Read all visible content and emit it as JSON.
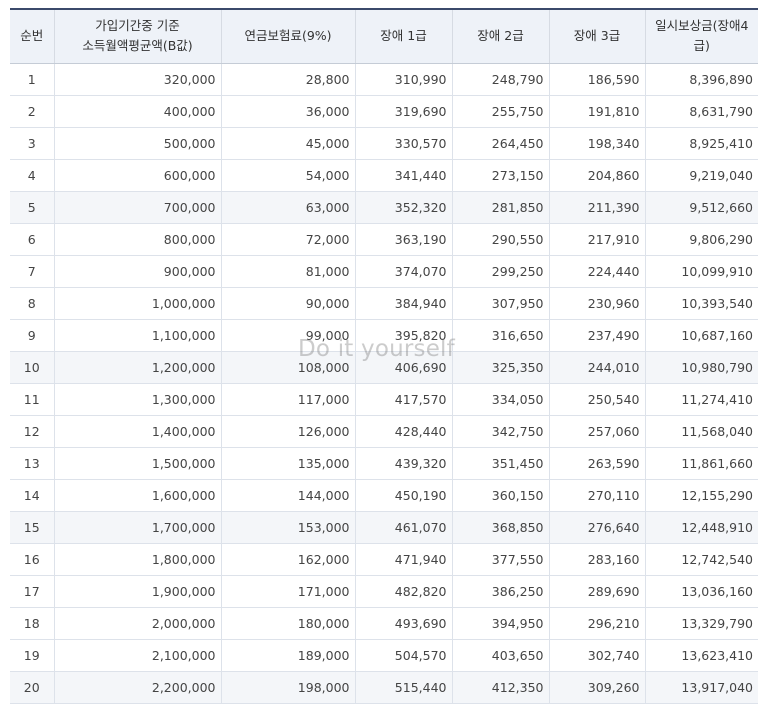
{
  "table": {
    "headers": {
      "no": "순번",
      "base_line1": "가입기간중 기준",
      "base_line2": "소득월액평균액(B값)",
      "premium": "연금보험료(9%)",
      "grade1": "장애 1급",
      "grade2": "장애 2급",
      "grade3": "장애 3급",
      "lump": "일시보상금(장애4급)"
    },
    "rows": [
      [
        "1",
        "320,000",
        "28,800",
        "310,990",
        "248,790",
        "186,590",
        "8,396,890"
      ],
      [
        "2",
        "400,000",
        "36,000",
        "319,690",
        "255,750",
        "191,810",
        "8,631,790"
      ],
      [
        "3",
        "500,000",
        "45,000",
        "330,570",
        "264,450",
        "198,340",
        "8,925,410"
      ],
      [
        "4",
        "600,000",
        "54,000",
        "341,440",
        "273,150",
        "204,860",
        "9,219,040"
      ],
      [
        "5",
        "700,000",
        "63,000",
        "352,320",
        "281,850",
        "211,390",
        "9,512,660"
      ],
      [
        "6",
        "800,000",
        "72,000",
        "363,190",
        "290,550",
        "217,910",
        "9,806,290"
      ],
      [
        "7",
        "900,000",
        "81,000",
        "374,070",
        "299,250",
        "224,440",
        "10,099,910"
      ],
      [
        "8",
        "1,000,000",
        "90,000",
        "384,940",
        "307,950",
        "230,960",
        "10,393,540"
      ],
      [
        "9",
        "1,100,000",
        "99,000",
        "395,820",
        "316,650",
        "237,490",
        "10,687,160"
      ],
      [
        "10",
        "1,200,000",
        "108,000",
        "406,690",
        "325,350",
        "244,010",
        "10,980,790"
      ],
      [
        "11",
        "1,300,000",
        "117,000",
        "417,570",
        "334,050",
        "250,540",
        "11,274,410"
      ],
      [
        "12",
        "1,400,000",
        "126,000",
        "428,440",
        "342,750",
        "257,060",
        "11,568,040"
      ],
      [
        "13",
        "1,500,000",
        "135,000",
        "439,320",
        "351,450",
        "263,590",
        "11,861,660"
      ],
      [
        "14",
        "1,600,000",
        "144,000",
        "450,190",
        "360,150",
        "270,110",
        "12,155,290"
      ],
      [
        "15",
        "1,700,000",
        "153,000",
        "461,070",
        "368,850",
        "276,640",
        "12,448,910"
      ],
      [
        "16",
        "1,800,000",
        "162,000",
        "471,940",
        "377,550",
        "283,160",
        "12,742,540"
      ],
      [
        "17",
        "1,900,000",
        "171,000",
        "482,820",
        "386,250",
        "289,690",
        "13,036,160"
      ],
      [
        "18",
        "2,000,000",
        "180,000",
        "493,690",
        "394,950",
        "296,210",
        "13,329,790"
      ],
      [
        "19",
        "2,100,000",
        "189,000",
        "504,570",
        "403,650",
        "302,740",
        "13,623,410"
      ],
      [
        "20",
        "2,200,000",
        "198,000",
        "515,440",
        "412,350",
        "309,260",
        "13,917,040"
      ]
    ]
  },
  "watermark": "Do it yourself"
}
